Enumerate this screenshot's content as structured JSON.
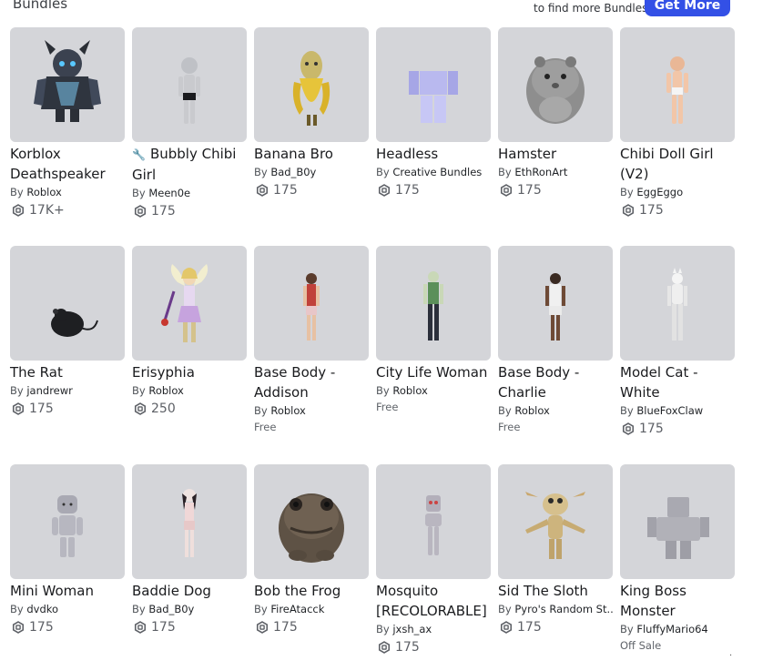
{
  "header": {
    "section_title": "Bundles",
    "promo_text": "to find more Bundles!",
    "get_more_label": "Get More"
  },
  "rows": [
    [
      {
        "name": "Korblox Deathspeaker",
        "creator": "Roblox",
        "price": "17K+",
        "icon": "korblox-deathspeaker-thumbnail"
      },
      {
        "name": "Bubbly Chibi Girl",
        "creator": "Meen0e",
        "price": "175",
        "prefix_icon": "wrench-icon",
        "icon": "bubbly-chibi-girl-thumbnail"
      },
      {
        "name": "Banana Bro",
        "creator": "Bad_B0y",
        "price": "175",
        "icon": "banana-bro-thumbnail"
      },
      {
        "name": "Headless",
        "creator": "Creative Bundles",
        "price": "175",
        "icon": "headless-thumbnail"
      },
      {
        "name": "Hamster",
        "creator": "EthRonArt",
        "price": "175",
        "icon": "hamster-thumbnail"
      },
      {
        "name": "Chibi Doll Girl (V2)",
        "creator": "EggEggo",
        "price": "175",
        "icon": "chibi-doll-girl-thumbnail"
      }
    ],
    [
      {
        "name": "The Rat",
        "creator": "jandrewr",
        "price": "175",
        "icon": "rat-thumbnail"
      },
      {
        "name": "Erisyphia",
        "creator": "Roblox",
        "price": "250",
        "icon": "erisyphia-thumbnail"
      },
      {
        "name": "Base Body - Addison",
        "creator": "Roblox",
        "status": "Free",
        "icon": "addison-thumbnail"
      },
      {
        "name": "City Life Woman",
        "creator": "Roblox",
        "status": "Free",
        "icon": "city-life-woman-thumbnail"
      },
      {
        "name": "Base Body - Charlie",
        "creator": "Roblox",
        "status": "Free",
        "icon": "charlie-thumbnail"
      },
      {
        "name": "Model Cat - White",
        "creator": "BlueFoxClaw",
        "price": "175",
        "icon": "model-cat-thumbnail"
      }
    ],
    [
      {
        "name": "Mini Woman",
        "creator": "dvdko",
        "price": "175",
        "icon": "mini-woman-thumbnail"
      },
      {
        "name": "Baddie Dog",
        "creator": "Bad_B0y",
        "price": "175",
        "icon": "baddie-dog-thumbnail"
      },
      {
        "name": "Bob the Frog",
        "creator": "FireAtacck",
        "price": "175",
        "icon": "frog-thumbnail"
      },
      {
        "name": "Mosquito [RECOLORABLE]",
        "creator": "jxsh_ax",
        "price": "175",
        "icon": "mosquito-thumbnail"
      },
      {
        "name": "Sid The Sloth",
        "creator": "Pyro's Random St...",
        "price": "175",
        "icon": "sloth-thumbnail"
      },
      {
        "name": "King Boss Monster",
        "creator": "FluffyMario64",
        "status": "Off Sale",
        "icon": "king-boss-monster-thumbnail"
      }
    ]
  ],
  "labels": {
    "by": "By"
  },
  "colors": {
    "accent": "#3350e6",
    "thumb_bg": "#d4d5d9"
  }
}
